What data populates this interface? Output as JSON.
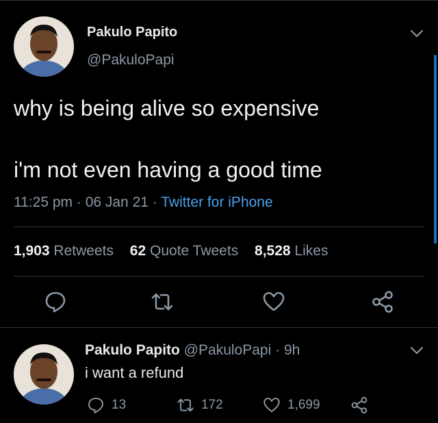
{
  "tweet": {
    "author_name": "Pakulo Papito",
    "author_handle": "@PakuloPapi",
    "line1": "why is being alive so expensive",
    "line2": "i'm not even having a good time",
    "time": "11:25 pm",
    "date": "06 Jan 21",
    "source": "Twitter for iPhone",
    "sep": "·",
    "retweets_count": "1,903",
    "retweets_label": "Retweets",
    "quotes_count": "62",
    "quotes_label": "Quote Tweets",
    "likes_count": "8,528",
    "likes_label": "Likes"
  },
  "reply": {
    "author_name": "Pakulo Papito",
    "author_handle": "@PakuloPapi",
    "age": "9h",
    "sep": "·",
    "text": "i want a refund",
    "replies": "13",
    "retweets": "172",
    "likes": "1,699"
  },
  "icons": [
    "reply-icon",
    "retweet-icon",
    "like-icon",
    "share-icon",
    "chevron-down-icon"
  ],
  "colors": {
    "background": "#000000",
    "link": "#4aa0ec",
    "muted": "#8b98a5",
    "text": "#f1f1f1"
  }
}
